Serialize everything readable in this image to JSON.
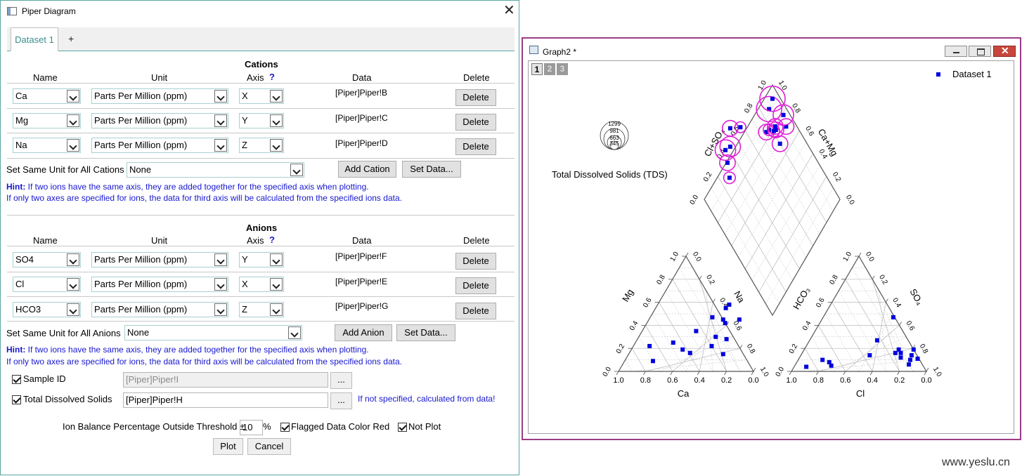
{
  "dialog": {
    "title": "Piper Diagram",
    "close_glyph": "✕",
    "tabs": [
      {
        "label": "Dataset 1"
      },
      {
        "label": "+"
      }
    ],
    "columns": {
      "name": "Name",
      "unit": "Unit",
      "axis": "Axis",
      "axis_help": "?",
      "data": "Data",
      "delete": "Delete"
    },
    "cations": {
      "title": "Cations",
      "rows": [
        {
          "name": "Ca",
          "unit": "Parts Per Million (ppm)",
          "axis": "X",
          "data": "[Piper]Piper!B",
          "delete": "Delete"
        },
        {
          "name": "Mg",
          "unit": "Parts Per Million (ppm)",
          "axis": "Y",
          "data": "[Piper]Piper!C",
          "delete": "Delete"
        },
        {
          "name": "Na",
          "unit": "Parts Per Million (ppm)",
          "axis": "Z",
          "data": "[Piper]Piper!D",
          "delete": "Delete"
        }
      ],
      "same_unit_label": "Set Same Unit for All Cations",
      "same_unit_value": "None",
      "add_button": "Add Cation",
      "set_data_button": "Set Data..."
    },
    "anions": {
      "title": "Anions",
      "rows": [
        {
          "name": "SO4",
          "unit": "Parts Per Million (ppm)",
          "axis": "Y",
          "data": "[Piper]Piper!F",
          "delete": "Delete"
        },
        {
          "name": "Cl",
          "unit": "Parts Per Million (ppm)",
          "axis": "X",
          "data": "[Piper]Piper!E",
          "delete": "Delete"
        },
        {
          "name": "HCO3",
          "unit": "Parts Per Million (ppm)",
          "axis": "Z",
          "data": "[Piper]Piper!G",
          "delete": "Delete"
        }
      ],
      "same_unit_label": "Set Same Unit for All Anions",
      "same_unit_value": "None",
      "add_button": "Add Anion",
      "set_data_button": "Set Data..."
    },
    "hint": {
      "label": "Hint:",
      "line1": " If two ions have the same axis, they are added together for the specified axis when plotting.",
      "line2": "If only two axes are specified for ions, the data for third axis will be calculated from the specified ions data."
    },
    "sample_id": {
      "label": "Sample ID",
      "checked": true,
      "value": "[Piper]Piper!I",
      "browse": "..."
    },
    "tds": {
      "label": "Total Dissolved Solids",
      "checked": true,
      "value": "[Piper]Piper!H",
      "browse": "...",
      "note": "If not specified, calculated from data!"
    },
    "ion_balance": {
      "label": "Ion Balance Percentage Outside Threshold ±",
      "value": "10",
      "unit": "%",
      "flagged_label": "Flagged Data Color Red",
      "flagged_checked": true,
      "not_plot_label": "Not Plot",
      "not_plot_checked": true
    },
    "plot_button": "Plot",
    "cancel_button": "Cancel"
  },
  "graph": {
    "window_title": "Graph2 *",
    "layers": [
      "1",
      "2",
      "3"
    ],
    "legend": "Dataset 1",
    "tds_legend": {
      "title": "Total Dissolved Solids (TDS)",
      "values": [
        "1299",
        "981",
        "663",
        "345"
      ]
    },
    "labels": {
      "cation_axis": "Ca",
      "cation_left": "Mg",
      "cation_right": "Na",
      "anion_axis": "Cl",
      "anion_left": "HCO₃",
      "anion_right": "SO₄",
      "diamond_left": "Cl+SO₄",
      "diamond_right": "Ca+Mg"
    },
    "colors": {
      "points": "#0000dd",
      "bubbles": "#e020d8",
      "grid": "#b8b8b8",
      "frame": "#555555",
      "border": "#9b3d86"
    }
  },
  "chart_data": [
    {
      "type": "scatter",
      "title": "",
      "xlabel": "Ca",
      "series": [
        {
          "name": "Dataset 1",
          "points": [
            [
              0.72,
              0.25
            ],
            [
              0.62,
              0.19
            ],
            [
              0.55,
              0.16
            ],
            [
              0.42,
              0.22
            ],
            [
              0.3,
              0.15
            ],
            [
              0.34,
              0.28
            ],
            [
              0.42,
              0.42
            ],
            [
              0.48,
              0.55
            ],
            [
              0.47,
              0.58
            ],
            [
              0.45,
              0.45
            ],
            [
              0.33,
              0.45
            ],
            [
              0.6,
              0.35
            ],
            [
              0.43,
              0.3
            ],
            [
              0.54,
              0.47
            ],
            [
              0.88,
              0.22
            ],
            [
              0.79,
              0.09
            ]
          ]
        }
      ],
      "tick_labels": [
        "0.0",
        "0.2",
        "0.4",
        "0.6",
        "0.8",
        "1.0"
      ]
    },
    {
      "type": "scatter",
      "title": "",
      "xlabel": "Cl",
      "series": [
        {
          "name": "Dataset 1",
          "points": [
            [
              0.12,
              0.11
            ],
            [
              0.16,
              0.06
            ],
            [
              0.17,
              0.1
            ],
            [
              0.18,
              0.14
            ],
            [
              0.19,
              0.19
            ],
            [
              0.27,
              0.16
            ],
            [
              0.3,
              0.19
            ],
            [
              0.31,
              0.16
            ],
            [
              0.25,
              0.12
            ],
            [
              0.48,
              0.47
            ],
            [
              0.5,
              0.27
            ],
            [
              0.49,
              0.14
            ],
            [
              0.73,
              0.05
            ],
            [
              0.76,
              0.08
            ],
            [
              0.91,
              0.04
            ],
            [
              0.82,
              0.1
            ]
          ]
        }
      ],
      "tick_labels": [
        "0.0",
        "0.2",
        "0.4",
        "0.6",
        "0.8",
        "1.0"
      ]
    },
    {
      "type": "scatter",
      "title": "",
      "series": [
        {
          "name": "Dataset 1",
          "points": [
            [
              0.33,
              0.49
            ],
            [
              0.28,
              0.41
            ],
            [
              0.37,
              0.56
            ],
            [
              0.42,
              0.54
            ],
            [
              0.5,
              0.62
            ],
            [
              0.58,
              0.55
            ],
            [
              0.75,
              0.34
            ],
            [
              0.78,
              0.33
            ],
            [
              0.8,
              0.19
            ],
            [
              0.81,
              0.29
            ],
            [
              0.83,
              0.28
            ],
            [
              0.87,
              0.42
            ],
            [
              0.92,
              0.22
            ],
            [
              0.95,
              0.29
            ],
            [
              0.84,
              0.3
            ],
            [
              0.94,
              0.44
            ]
          ]
        }
      ],
      "tds": [
        663,
        400,
        981,
        981,
        663,
        345,
        663,
        400,
        663,
        400,
        663,
        1299,
        663,
        981,
        663,
        1299
      ]
    }
  ]
}
